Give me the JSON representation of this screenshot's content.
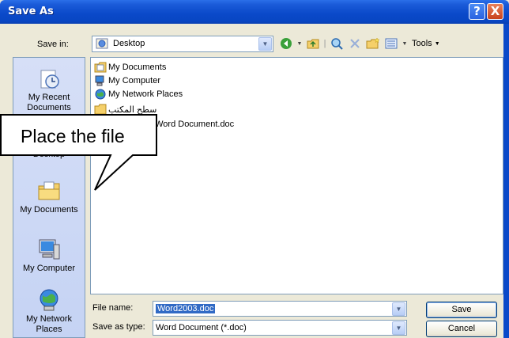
{
  "window": {
    "title": "Save As"
  },
  "titlebar_buttons": {
    "help": "?",
    "close": "X"
  },
  "save_in": {
    "label": "Save in:",
    "value": "Desktop"
  },
  "toolbar": {
    "tools_label": "Tools"
  },
  "places": [
    {
      "label": "My Recent Documents",
      "icon": "recent-documents-icon"
    },
    {
      "label": "Desktop",
      "icon": "desktop-icon"
    },
    {
      "label": "My Documents",
      "icon": "my-documents-icon"
    },
    {
      "label": "My Computer",
      "icon": "my-computer-icon"
    },
    {
      "label": "My Network Places",
      "icon": "network-places-icon"
    }
  ],
  "files": [
    {
      "name": "My Documents",
      "icon": "folder-icon"
    },
    {
      "name": "My Computer",
      "icon": "computer-icon"
    },
    {
      "name": "My Network Places",
      "icon": "network-icon"
    },
    {
      "name": "سطح المكتب",
      "icon": "folder-icon"
    },
    {
      "name": "t Word Document.doc",
      "icon": "word-doc-icon"
    }
  ],
  "file_name": {
    "label": "File name:",
    "value": "Word2003.doc"
  },
  "save_as_type": {
    "label": "Save as type:",
    "value": "Word Document (*.doc)"
  },
  "buttons": {
    "save": "Save",
    "cancel": "Cancel"
  },
  "callout": {
    "text": "Place the file"
  }
}
